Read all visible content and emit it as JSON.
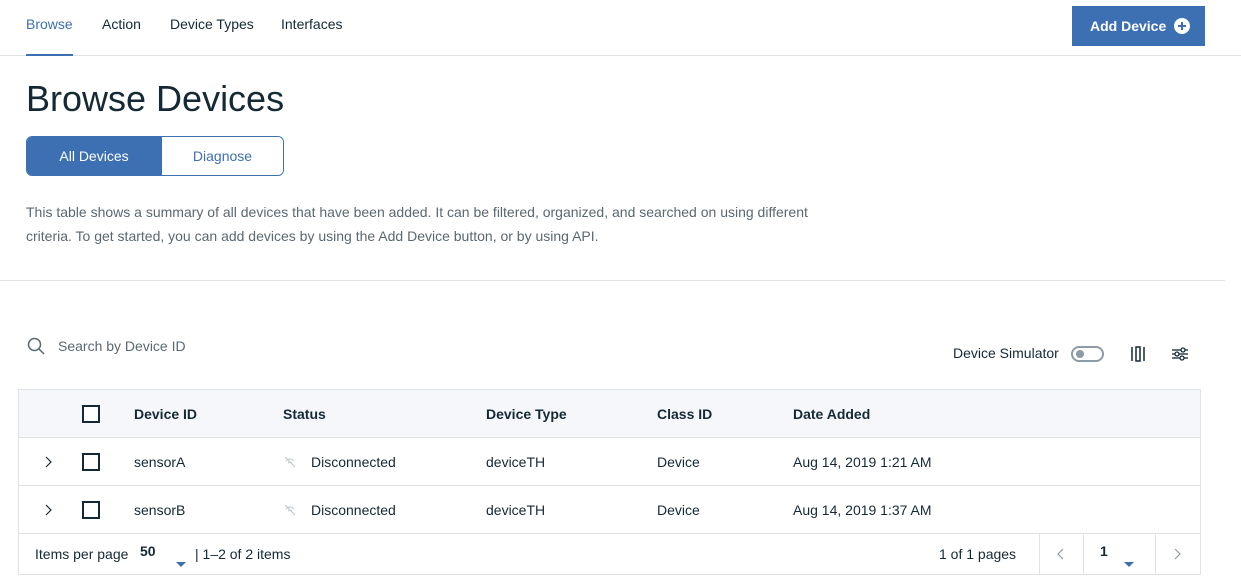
{
  "nav": {
    "tabs": [
      {
        "label": "Browse",
        "active": true
      },
      {
        "label": "Action",
        "active": false
      },
      {
        "label": "Device Types",
        "active": false
      },
      {
        "label": "Interfaces",
        "active": false
      }
    ],
    "add_button_label": "Add Device",
    "add_button_icon": "plus-circle-icon"
  },
  "page": {
    "title": "Browse Devices",
    "segments": [
      "All Devices",
      "Diagnose"
    ],
    "description": "This table shows a summary of all devices that have been added. It can be filtered, organized, and searched on using different criteria. To get started, you can add devices by using the Add Device button, or by using API."
  },
  "toolbar": {
    "search_placeholder": "Search by Device ID",
    "simulator_label": "Device Simulator",
    "simulator_on": false
  },
  "table": {
    "columns": [
      "Device ID",
      "Status",
      "Device Type",
      "Class ID",
      "Date Added"
    ],
    "rows": [
      {
        "device_id": "sensorA",
        "status": "Disconnected",
        "device_type": "deviceTH",
        "class_id": "Device",
        "date_added": "Aug 14, 2019 1:21 AM"
      },
      {
        "device_id": "sensorB",
        "status": "Disconnected",
        "device_type": "deviceTH",
        "class_id": "Device",
        "date_added": "Aug 14, 2019 1:37 AM"
      }
    ]
  },
  "pagination": {
    "items_per_page_label": "Items per page",
    "items_per_page": "50",
    "range": "|  1–2 of 2 items",
    "page_of": "1 of 1 pages",
    "current_page": "1"
  },
  "colors": {
    "accent": "#3d70b2",
    "text": "#152935",
    "border": "#dfe3e6",
    "header_bg": "#f5f7fa"
  }
}
